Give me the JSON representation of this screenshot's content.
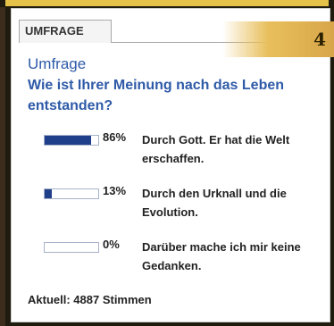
{
  "colors": {
    "accent_blue": "#2e5aa8",
    "bar_blue": "#1f3f8a",
    "header_gold": "#e5c24a",
    "badge_gold": "#e8bf5c"
  },
  "tab": {
    "label": "UMFRAGE"
  },
  "badge": {
    "number": "4"
  },
  "poll": {
    "title": "Umfrage",
    "question": "Wie ist Ihrer Meinung nach das Leben entstanden?",
    "answers": [
      {
        "percent_label": "86%",
        "percent": 86,
        "text": "Durch Gott. Er hat die Welt erschaffen."
      },
      {
        "percent_label": "13%",
        "percent": 13,
        "text": "Durch den Urknall und die Evolution."
      },
      {
        "percent_label": "0%",
        "percent": 0,
        "text": "Darüber mache ich mir keine Gedanken."
      }
    ],
    "total_label": "Aktuell: 4887 Stimmen"
  }
}
